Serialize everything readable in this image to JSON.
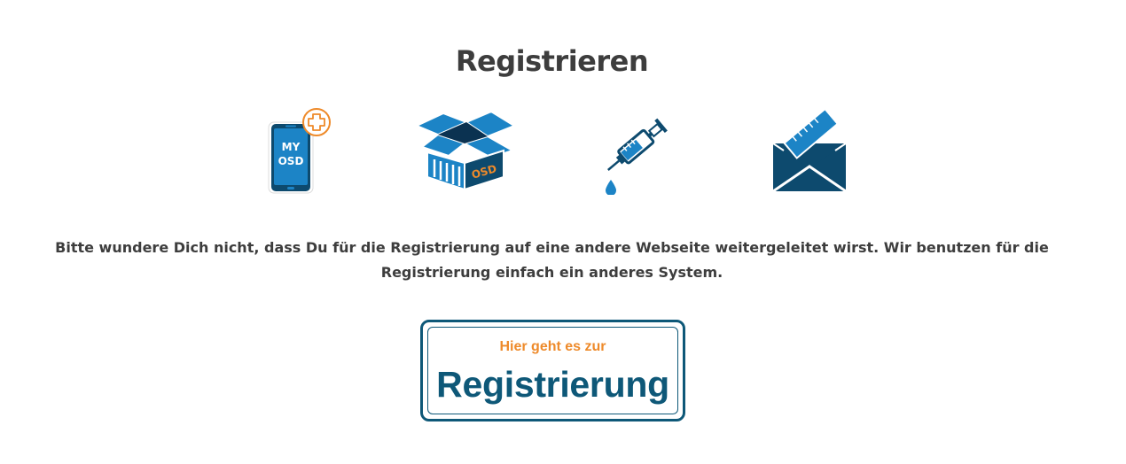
{
  "page": {
    "title": "Registrieren",
    "info_text": "Bitte wundere Dich nicht, dass Du für die Registrierung auf eine andere Webseite weitergeleitet wirst. Wir benutzen für die Registrierung einfach ein anderes System."
  },
  "icons": [
    {
      "name": "phone-app-icon",
      "label_line1": "MY",
      "label_line2": "OSD"
    },
    {
      "name": "box-icon",
      "label": "OSD"
    },
    {
      "name": "syringe-icon"
    },
    {
      "name": "envelope-icon"
    }
  ],
  "register_button": {
    "top_text": "Hier geht es zur",
    "main_text": "Registrierung"
  },
  "colors": {
    "dark_blue": "#0d4a6e",
    "blue": "#0e77b5",
    "orange": "#ee8a2a",
    "text": "#3d3d3d"
  }
}
